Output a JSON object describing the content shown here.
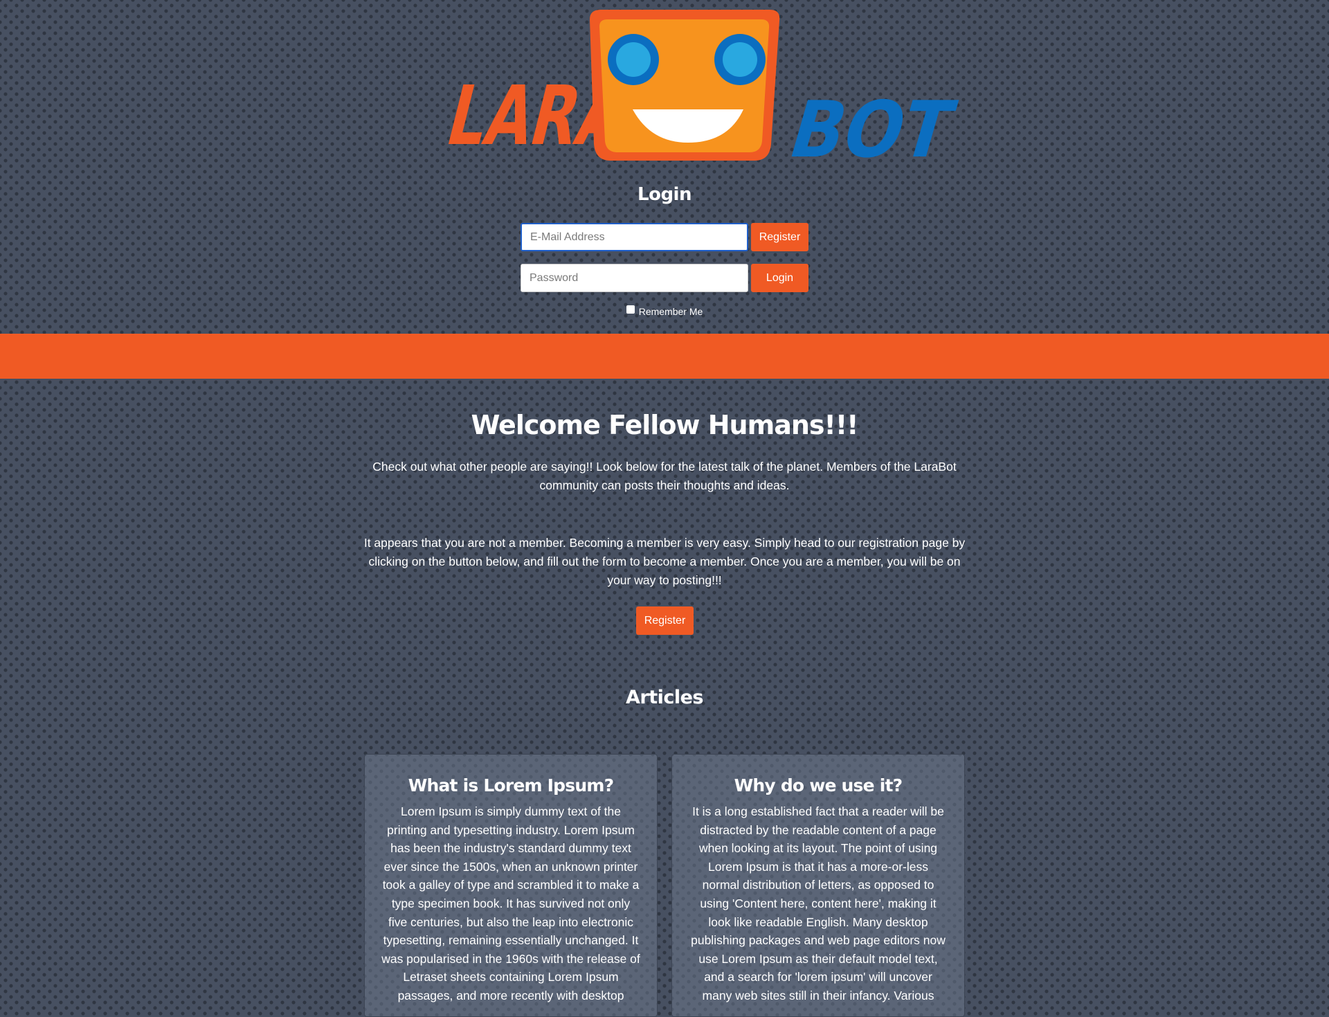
{
  "logo": {
    "left_word": "LARA",
    "right_word": "BOT",
    "colors": {
      "orange": "#f05a24",
      "face": "#f7931e",
      "blue": "#0b6ec0",
      "eye": "#29a8e0"
    }
  },
  "login": {
    "title": "Login",
    "email_placeholder": "E-Mail Address",
    "password_placeholder": "Password",
    "register_label": "Register",
    "login_label": "Login",
    "remember_label": "Remember Me"
  },
  "welcome": {
    "title": "Welcome Fellow Humans!!!",
    "intro": "Check out what other people are saying!! Look below for the latest talk of the planet. Members of the LaraBot community can posts their thoughts and ideas.",
    "member_text": "It appears that you are not a member. Becoming a member is very easy. Simply head to our registration page by clicking on the button below, and fill out the form to become a member. Once you are a member, you will be on your way to posting!!!",
    "register_label": "Register"
  },
  "articles": {
    "title": "Articles",
    "items": [
      {
        "title": "What is Lorem Ipsum?",
        "body": "Lorem Ipsum is simply dummy text of the printing and typesetting industry. Lorem Ipsum has been the industry's standard dummy text ever since the 1500s, when an unknown printer took a galley of type and scrambled it to make a type specimen book. It has survived not only five centuries, but also the leap into electronic typesetting, remaining essentially unchanged. It was popularised in the 1960s with the release of Letraset sheets containing Lorem Ipsum passages, and more recently with desktop"
      },
      {
        "title": "Why do we use it?",
        "body": "It is a long established fact that a reader will be distracted by the readable content of a page when looking at its layout. The point of using Lorem Ipsum is that it has a more-or-less normal distribution of letters, as opposed to using 'Content here, content here', making it look like readable English. Many desktop publishing packages and web page editors now use Lorem Ipsum as their default model text, and a search for 'lorem ipsum' will uncover many web sites still in their infancy. Various"
      }
    ]
  }
}
